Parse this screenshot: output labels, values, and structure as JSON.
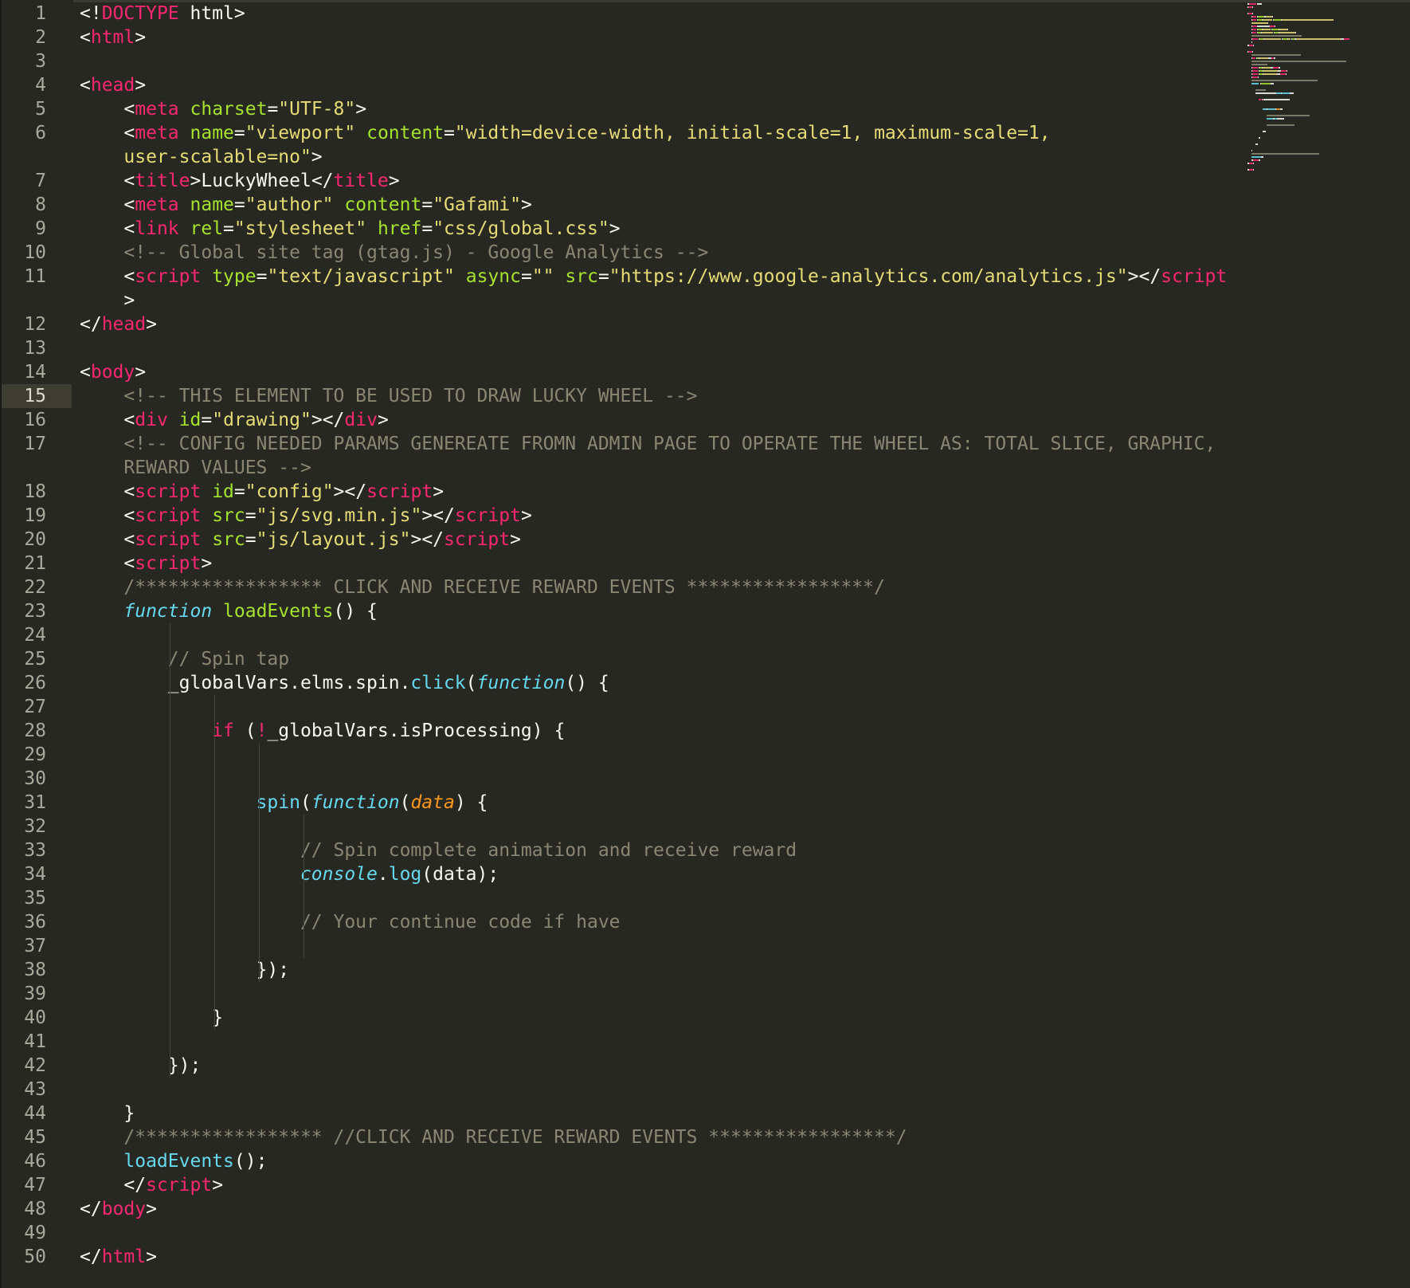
{
  "editor": {
    "theme": {
      "background": "#272822",
      "tag": "#f92672",
      "attribute": "#a6e22e",
      "string": "#e6db74",
      "comment": "#8a8672",
      "function": "#66d9ef",
      "parameter": "#fd971f",
      "text": "#f8f8f2"
    },
    "active_line": 15,
    "lines": [
      {
        "n": "1",
        "tokens": [
          [
            "plain",
            "<!"
          ],
          [
            "tag",
            "DOCTYPE"
          ],
          [
            "plain",
            " html>"
          ]
        ]
      },
      {
        "n": "2",
        "tokens": [
          [
            "plain",
            "<"
          ],
          [
            "tag",
            "html"
          ],
          [
            "plain",
            ">"
          ]
        ]
      },
      {
        "n": "3",
        "tokens": []
      },
      {
        "n": "4",
        "tokens": [
          [
            "plain",
            "<"
          ],
          [
            "tag",
            "head"
          ],
          [
            "plain",
            ">"
          ]
        ]
      },
      {
        "n": "5",
        "tokens": [
          [
            "plain",
            "    <"
          ],
          [
            "tag",
            "meta"
          ],
          [
            "plain",
            " "
          ],
          [
            "attr",
            "charset"
          ],
          [
            "plain",
            "="
          ],
          [
            "str",
            "\"UTF-8\""
          ],
          [
            "plain",
            ">"
          ]
        ]
      },
      {
        "n": "6",
        "tokens": [
          [
            "plain",
            "    <"
          ],
          [
            "tag",
            "meta"
          ],
          [
            "plain",
            " "
          ],
          [
            "attr",
            "name"
          ],
          [
            "plain",
            "="
          ],
          [
            "str",
            "\"viewport\""
          ],
          [
            "plain",
            " "
          ],
          [
            "attr",
            "content"
          ],
          [
            "plain",
            "="
          ],
          [
            "str",
            "\"width=device-width, initial-scale=1, maximum-scale=1,"
          ]
        ]
      },
      {
        "n": "",
        "tokens": [
          [
            "str",
            "    user-scalable=no\""
          ],
          [
            "plain",
            ">"
          ]
        ]
      },
      {
        "n": "7",
        "tokens": [
          [
            "plain",
            "    <"
          ],
          [
            "tag",
            "title"
          ],
          [
            "plain",
            ">LuckyWheel</"
          ],
          [
            "tag",
            "title"
          ],
          [
            "plain",
            ">"
          ]
        ]
      },
      {
        "n": "8",
        "tokens": [
          [
            "plain",
            "    <"
          ],
          [
            "tag",
            "meta"
          ],
          [
            "plain",
            " "
          ],
          [
            "attr",
            "name"
          ],
          [
            "plain",
            "="
          ],
          [
            "str",
            "\"author\""
          ],
          [
            "plain",
            " "
          ],
          [
            "attr",
            "content"
          ],
          [
            "plain",
            "="
          ],
          [
            "str",
            "\"Gafami\""
          ],
          [
            "plain",
            ">"
          ]
        ]
      },
      {
        "n": "9",
        "tokens": [
          [
            "plain",
            "    <"
          ],
          [
            "tag",
            "link"
          ],
          [
            "plain",
            " "
          ],
          [
            "attr",
            "rel"
          ],
          [
            "plain",
            "="
          ],
          [
            "str",
            "\"stylesheet\""
          ],
          [
            "plain",
            " "
          ],
          [
            "attr",
            "href"
          ],
          [
            "plain",
            "="
          ],
          [
            "str",
            "\"css/global.css\""
          ],
          [
            "plain",
            ">"
          ]
        ]
      },
      {
        "n": "10",
        "tokens": [
          [
            "cmt",
            "    <!-- Global site tag (gtag.js) - Google Analytics -->"
          ]
        ]
      },
      {
        "n": "11",
        "tokens": [
          [
            "plain",
            "    <"
          ],
          [
            "tag",
            "script"
          ],
          [
            "plain",
            " "
          ],
          [
            "attr",
            "type"
          ],
          [
            "plain",
            "="
          ],
          [
            "str",
            "\"text/javascript\""
          ],
          [
            "plain",
            " "
          ],
          [
            "attr",
            "async"
          ],
          [
            "plain",
            "="
          ],
          [
            "str",
            "\"\""
          ],
          [
            "plain",
            " "
          ],
          [
            "attr",
            "src"
          ],
          [
            "plain",
            "="
          ],
          [
            "str",
            "\"https://www.google-analytics.com/analytics.js\""
          ],
          [
            "plain",
            "></"
          ],
          [
            "tag",
            "script"
          ]
        ]
      },
      {
        "n": "",
        "tokens": [
          [
            "plain",
            "    >"
          ]
        ]
      },
      {
        "n": "12",
        "tokens": [
          [
            "plain",
            "</"
          ],
          [
            "tag",
            "head"
          ],
          [
            "plain",
            ">"
          ]
        ]
      },
      {
        "n": "13",
        "tokens": []
      },
      {
        "n": "14",
        "tokens": [
          [
            "plain",
            "<"
          ],
          [
            "tag",
            "body"
          ],
          [
            "plain",
            ">"
          ]
        ]
      },
      {
        "n": "15",
        "tokens": [
          [
            "cmt",
            "    <!-- THIS ELEMENT TO BE USED TO DRAW LUCKY WHEEL -->"
          ]
        ]
      },
      {
        "n": "16",
        "tokens": [
          [
            "plain",
            "    <"
          ],
          [
            "tag",
            "div"
          ],
          [
            "plain",
            " "
          ],
          [
            "attr",
            "id"
          ],
          [
            "plain",
            "="
          ],
          [
            "str",
            "\"drawing\""
          ],
          [
            "plain",
            "></"
          ],
          [
            "tag",
            "div"
          ],
          [
            "plain",
            ">"
          ]
        ]
      },
      {
        "n": "17",
        "tokens": [
          [
            "cmt",
            "    <!-- CONFIG NEEDED PARAMS GENEREATE FROMN ADMIN PAGE TO OPERATE THE WHEEL AS: TOTAL SLICE, GRAPHIC,"
          ]
        ]
      },
      {
        "n": "",
        "tokens": [
          [
            "cmt",
            "    REWARD VALUES -->"
          ]
        ]
      },
      {
        "n": "18",
        "tokens": [
          [
            "plain",
            "    <"
          ],
          [
            "tag",
            "script"
          ],
          [
            "plain",
            " "
          ],
          [
            "attr",
            "id"
          ],
          [
            "plain",
            "="
          ],
          [
            "str",
            "\"config\""
          ],
          [
            "plain",
            "></"
          ],
          [
            "tag",
            "script"
          ],
          [
            "plain",
            ">"
          ]
        ]
      },
      {
        "n": "19",
        "tokens": [
          [
            "plain",
            "    <"
          ],
          [
            "tag",
            "script"
          ],
          [
            "plain",
            " "
          ],
          [
            "attr",
            "src"
          ],
          [
            "plain",
            "="
          ],
          [
            "str",
            "\"js/svg.min.js\""
          ],
          [
            "plain",
            "></"
          ],
          [
            "tag",
            "script"
          ],
          [
            "plain",
            ">"
          ]
        ]
      },
      {
        "n": "20",
        "tokens": [
          [
            "plain",
            "    <"
          ],
          [
            "tag",
            "script"
          ],
          [
            "plain",
            " "
          ],
          [
            "attr",
            "src"
          ],
          [
            "plain",
            "="
          ],
          [
            "str",
            "\"js/layout.js\""
          ],
          [
            "plain",
            "></"
          ],
          [
            "tag",
            "script"
          ],
          [
            "plain",
            ">"
          ]
        ]
      },
      {
        "n": "21",
        "tokens": [
          [
            "plain",
            "    <"
          ],
          [
            "tag",
            "script"
          ],
          [
            "plain",
            ">"
          ]
        ]
      },
      {
        "n": "22",
        "tokens": [
          [
            "cmt",
            "    /***************** CLICK AND RECEIVE REWARD EVENTS *****************/"
          ]
        ]
      },
      {
        "n": "23",
        "tokens": [
          [
            "it",
            "    function"
          ],
          [
            "plain",
            " "
          ],
          [
            "attr",
            "loadEvents"
          ],
          [
            "plain",
            "() {"
          ]
        ]
      },
      {
        "n": "24",
        "tokens": []
      },
      {
        "n": "25",
        "tokens": [
          [
            "cmt",
            "        // Spin tap"
          ]
        ]
      },
      {
        "n": "26",
        "tokens": [
          [
            "plain",
            "        _globalVars.elms.spin."
          ],
          [
            "fn",
            "click"
          ],
          [
            "plain",
            "("
          ],
          [
            "it",
            "function"
          ],
          [
            "plain",
            "() {"
          ]
        ]
      },
      {
        "n": "27",
        "tokens": []
      },
      {
        "n": "28",
        "tokens": [
          [
            "kw",
            "            if"
          ],
          [
            "plain",
            " ("
          ],
          [
            "kw",
            "!"
          ],
          [
            "plain",
            "_globalVars.isProcessing) {"
          ]
        ]
      },
      {
        "n": "29",
        "tokens": []
      },
      {
        "n": "30",
        "tokens": []
      },
      {
        "n": "31",
        "tokens": [
          [
            "fn",
            "                spin"
          ],
          [
            "plain",
            "("
          ],
          [
            "it",
            "function"
          ],
          [
            "plain",
            "("
          ],
          [
            "param",
            "data"
          ],
          [
            "plain",
            ") {"
          ]
        ]
      },
      {
        "n": "32",
        "tokens": []
      },
      {
        "n": "33",
        "tokens": [
          [
            "cmt",
            "                    // Spin complete animation and receive reward"
          ]
        ]
      },
      {
        "n": "34",
        "tokens": [
          [
            "it",
            "                    console"
          ],
          [
            "plain",
            "."
          ],
          [
            "fn",
            "log"
          ],
          [
            "plain",
            "(data);"
          ]
        ]
      },
      {
        "n": "35",
        "tokens": []
      },
      {
        "n": "36",
        "tokens": [
          [
            "cmt",
            "                    // Your continue code if have"
          ]
        ]
      },
      {
        "n": "37",
        "tokens": []
      },
      {
        "n": "38",
        "tokens": [
          [
            "plain",
            "                });"
          ]
        ]
      },
      {
        "n": "39",
        "tokens": []
      },
      {
        "n": "40",
        "tokens": [
          [
            "plain",
            "            }"
          ]
        ]
      },
      {
        "n": "41",
        "tokens": []
      },
      {
        "n": "42",
        "tokens": [
          [
            "plain",
            "        });"
          ]
        ]
      },
      {
        "n": "43",
        "tokens": []
      },
      {
        "n": "44",
        "tokens": [
          [
            "plain",
            "    }"
          ]
        ]
      },
      {
        "n": "45",
        "tokens": [
          [
            "cmt",
            "    /***************** //CLICK AND RECEIVE REWARD EVENTS *****************/"
          ]
        ]
      },
      {
        "n": "46",
        "tokens": [
          [
            "fn",
            "    loadEvents"
          ],
          [
            "plain",
            "();"
          ]
        ]
      },
      {
        "n": "47",
        "tokens": [
          [
            "plain",
            "    </"
          ],
          [
            "tag",
            "script"
          ],
          [
            "plain",
            ">"
          ]
        ]
      },
      {
        "n": "48",
        "tokens": [
          [
            "plain",
            "</"
          ],
          [
            "tag",
            "body"
          ],
          [
            "plain",
            ">"
          ]
        ]
      },
      {
        "n": "49",
        "tokens": []
      },
      {
        "n": "50",
        "tokens": [
          [
            "plain",
            "</"
          ],
          [
            "tag",
            "html"
          ],
          [
            "plain",
            ">"
          ]
        ]
      }
    ]
  }
}
